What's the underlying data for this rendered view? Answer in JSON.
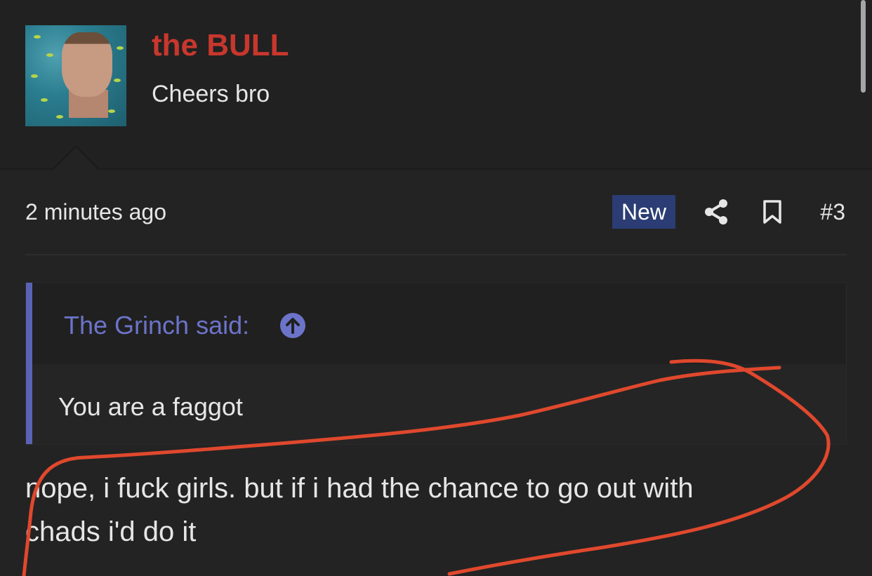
{
  "post_header": {
    "username": "the BULL",
    "user_title": "Cheers bro"
  },
  "post_meta": {
    "timestamp": "2 minutes ago",
    "new_badge": "New",
    "post_number": "#3"
  },
  "quote": {
    "author": "The Grinch said:",
    "text": "You are a faggot"
  },
  "message": {
    "line1": "nope, i fuck girls. but if i had the chance to go out with",
    "line2": "chads i'd do it"
  },
  "colors": {
    "background": "#232323",
    "username": "#c8372d",
    "new_badge": "#2b3d74",
    "quote_accent": "#5a62b5",
    "annotation_stroke": "#e0482d"
  },
  "icons": [
    "share-icon",
    "bookmark-icon",
    "arrow-up-circle-icon"
  ]
}
